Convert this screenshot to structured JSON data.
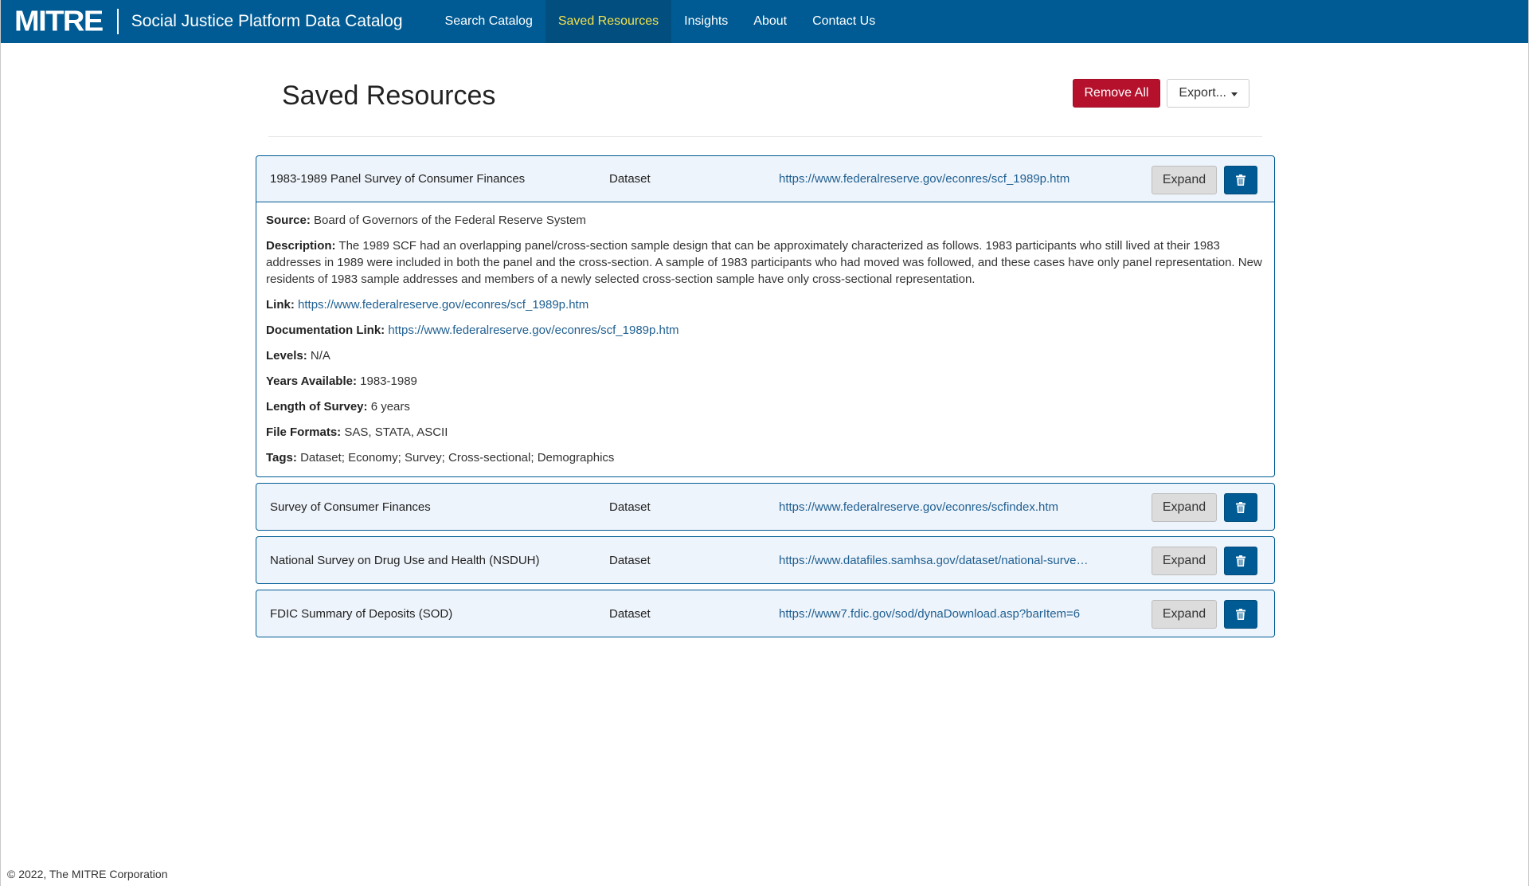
{
  "navbar": {
    "logo": "MITRE",
    "title": "Social Justice Platform Data Catalog",
    "links": [
      "Search Catalog",
      "Saved Resources",
      "Insights",
      "About",
      "Contact Us"
    ],
    "active_link": "Saved Resources"
  },
  "page": {
    "title": "Saved Resources",
    "remove_all_label": "Remove All",
    "export_label": "Export..."
  },
  "resources": [
    {
      "title": "1983-1989 Panel Survey of Consumer Finances",
      "type": "Dataset",
      "link": "https://www.federalreserve.gov/econres/scf_1989p.htm",
      "expand_label": "Expand",
      "expanded": true,
      "details": {
        "source_label": "Source:",
        "source": "Board of Governors of the Federal Reserve System",
        "description_label": "Description:",
        "description": "The 1989 SCF had an overlapping panel/cross-section sample design that can be approximately characterized as follows. 1983 participants who still lived at their 1983 addresses in 1989 were included in both the panel and the cross-section. A sample of 1983 participants who had moved was followed, and these cases have only panel representation. New residents of 1983 sample addresses and members of a newly selected cross-section sample have only cross-sectional representation.",
        "link_label": "Link:",
        "link": "https://www.federalreserve.gov/econres/scf_1989p.htm",
        "doc_link_label": "Documentation Link:",
        "doc_link": "https://www.federalreserve.gov/econres/scf_1989p.htm",
        "levels_label": "Levels:",
        "levels": "N/A",
        "years_label": "Years Available:",
        "years": "1983-1989",
        "length_label": "Length of Survey:",
        "length": "6 years",
        "formats_label": "File Formats:",
        "formats": "SAS, STATA, ASCII",
        "tags_label": "Tags:",
        "tags": "Dataset; Economy; Survey; Cross-sectional; Demographics"
      }
    },
    {
      "title": "Survey of Consumer Finances",
      "type": "Dataset",
      "link": "https://www.federalreserve.gov/econres/scfindex.htm",
      "expand_label": "Expand",
      "expanded": false
    },
    {
      "title": "National Survey on Drug Use and Health (NSDUH)",
      "type": "Dataset",
      "link": "https://www.datafiles.samhsa.gov/dataset/national-survey-drug-use-and-health-nsduh",
      "expand_label": "Expand",
      "expanded": false
    },
    {
      "title": "FDIC Summary of Deposits (SOD)",
      "type": "Dataset",
      "link": "https://www7.fdic.gov/sod/dynaDownload.asp?barItem=6",
      "expand_label": "Expand",
      "expanded": false
    }
  ],
  "footer": {
    "text": "© 2022, The MITRE Corporation"
  },
  "icons": {
    "delete": "trash-icon",
    "export_caret": "caret-down-icon"
  },
  "colors": {
    "navbar": "#005b94",
    "active_nav_text": "#f4e04d",
    "danger": "#b5112c",
    "card_border": "#005b94",
    "card_head_bg": "#eef4fb"
  }
}
